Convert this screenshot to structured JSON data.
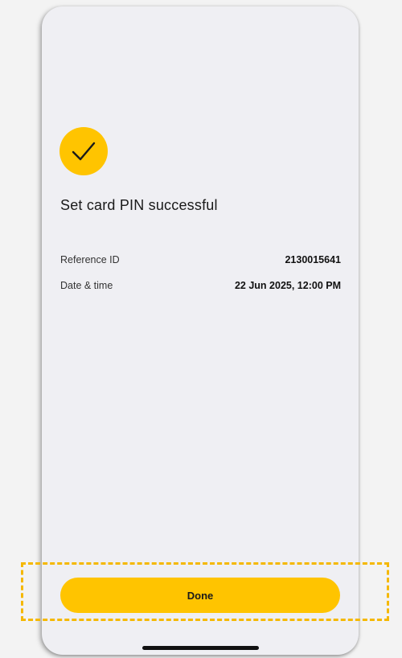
{
  "screen": {
    "title": "Set card PIN successful",
    "icon": "checkmark-icon"
  },
  "details": [
    {
      "label": "Reference ID",
      "value": "2130015641"
    },
    {
      "label": "Date & time",
      "value": "22 Jun 2025, 12:00 PM"
    }
  ],
  "actions": {
    "done_label": "Done"
  },
  "colors": {
    "accent": "#ffc400",
    "background": "#efeff3",
    "highlight": "#f5b800"
  }
}
